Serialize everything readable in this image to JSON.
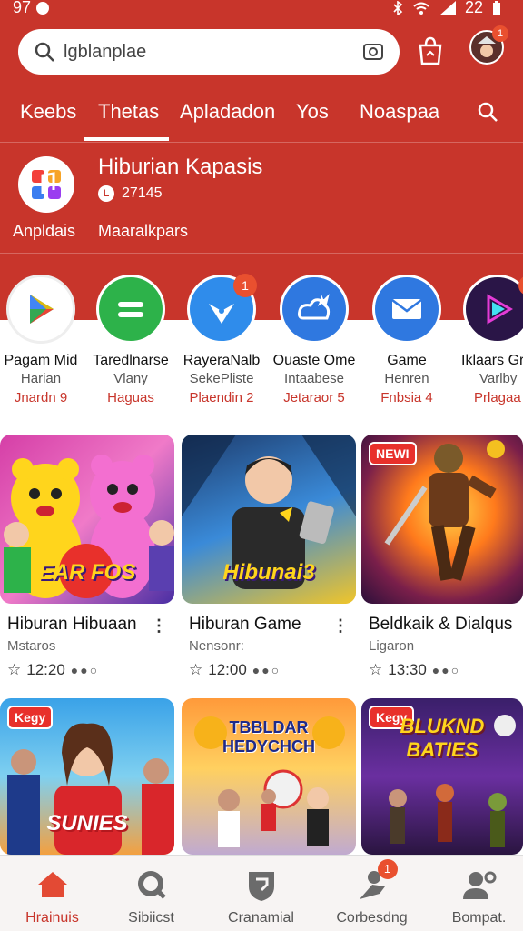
{
  "status": {
    "time": "97",
    "clock": "22"
  },
  "search": {
    "placeholder": "lgblanplae"
  },
  "header": {
    "badge_count": "1"
  },
  "tabs": [
    "Keebs",
    "Thetas",
    "Apladadon",
    "Yos",
    "Noaspaa"
  ],
  "featured": {
    "title": "Hiburian Kapasis",
    "meta": "27145",
    "meta_badge": "L",
    "label_left": "Anpldais",
    "label_right": "Maaralkpars"
  },
  "apps": [
    {
      "name": "Pagam Mid",
      "sub": "Harian",
      "stat": "Jnardn 9",
      "icon": "play-store-icon",
      "color": "#ffffff",
      "badge": ""
    },
    {
      "name": "Taredlnarse",
      "sub": "Vlany",
      "stat": "Haguas",
      "icon": "equals-icon",
      "color": "#2db24a",
      "badge": ""
    },
    {
      "name": "RayeraNalb",
      "sub": "SekePliste",
      "stat": "Plaendin 2",
      "icon": "compass-icon",
      "color": "#2f8ceb",
      "badge": "1"
    },
    {
      "name": "Ouaste Ome",
      "sub": "Intaabese",
      "stat": "Jetaraor 5",
      "icon": "cloud-star-icon",
      "color": "#2f78e0",
      "badge": ""
    },
    {
      "name": "Game",
      "sub": "Henren",
      "stat": "Fnbsia 4",
      "icon": "mail-icon",
      "color": "#2f78e0",
      "badge": ""
    },
    {
      "name": "Iklaars Gr",
      "sub": "Varlby",
      "stat": "Prlagaa ...",
      "icon": "neon-play-icon",
      "color": "#2a1547",
      "badge": "1"
    }
  ],
  "cards": [
    {
      "title": "Hiburan Hibuaan",
      "sub": "Mstaros",
      "time": "12:20",
      "caption": "EAR FOS",
      "badge": "",
      "icon": "bear-game-thumb"
    },
    {
      "title": "Hiburan Game",
      "sub": "Nensonr:",
      "time": "12:00",
      "caption": "Hibunai3",
      "badge": "",
      "icon": "boy-game-thumb"
    },
    {
      "title": "Beldkaik & Dialqus",
      "sub": "Ligaron",
      "time": "13:30",
      "caption": "",
      "badge": "NEWI",
      "icon": "warrior-game-thumb"
    },
    {
      "title": "",
      "sub": "",
      "time": "",
      "caption": "SUNIES",
      "badge": "Kegy",
      "icon": "girl-show-thumb"
    },
    {
      "title": "",
      "sub": "",
      "time": "",
      "caption": "TBBLDAR HEDYCHCH",
      "badge": "",
      "icon": "kids-game-thumb"
    },
    {
      "title": "",
      "sub": "",
      "time": "",
      "caption": "BLUKND BATIES",
      "badge": "Kegy",
      "icon": "battle-game-thumb"
    }
  ],
  "bottom_nav": [
    {
      "label": "Hrainuis",
      "icon": "home-icon",
      "badge": ""
    },
    {
      "label": "Sibiicst",
      "icon": "search-icon",
      "badge": ""
    },
    {
      "label": "Cranamial",
      "icon": "shield-icon",
      "badge": ""
    },
    {
      "label": "Corbesdng",
      "icon": "person-pin-icon",
      "badge": "1"
    },
    {
      "label": "Bompat.",
      "icon": "account-icon",
      "badge": ""
    }
  ],
  "colors": {
    "brand": "#c8352b",
    "accent_badge": "#e9502f"
  }
}
